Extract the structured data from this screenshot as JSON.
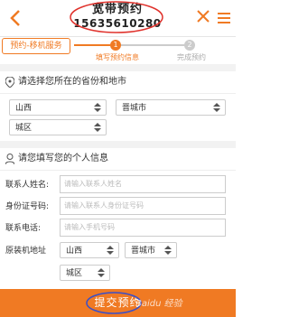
{
  "header": {
    "title": "宽带预约",
    "phone": "15635610280",
    "icons": {
      "back": "chevron-left-icon",
      "close": "close-icon",
      "more": "menu-icon"
    },
    "accent": "#f07a23",
    "annotation_color": "#e0322c"
  },
  "progress": {
    "service_label": "预约-移机服务",
    "steps": [
      {
        "number": "1",
        "label": "填写预约信息",
        "active": true
      },
      {
        "number": "2",
        "label": "完成预约",
        "active": false
      }
    ]
  },
  "region_section": {
    "heading": "请选择您所在的省份和地市",
    "icon": "location-pin-icon",
    "province": "山西",
    "city": "晋城市",
    "district": "城区"
  },
  "personal_section": {
    "heading": "请您填写您的个人信息",
    "icon": "user-icon",
    "fields": [
      {
        "label": "联系人姓名:",
        "placeholder": "请输入联系人姓名"
      },
      {
        "label": "身份证号码:",
        "placeholder": "请输入联系人身份证号码"
      },
      {
        "label": "联系电话:",
        "placeholder": "请输入手机号码"
      }
    ],
    "address_label": "原装机地址",
    "address_province": "山西",
    "address_city": "晋城市",
    "address_district": "城区"
  },
  "footer": {
    "submit_label": "提交预约",
    "watermark": "Baidu 经验"
  }
}
